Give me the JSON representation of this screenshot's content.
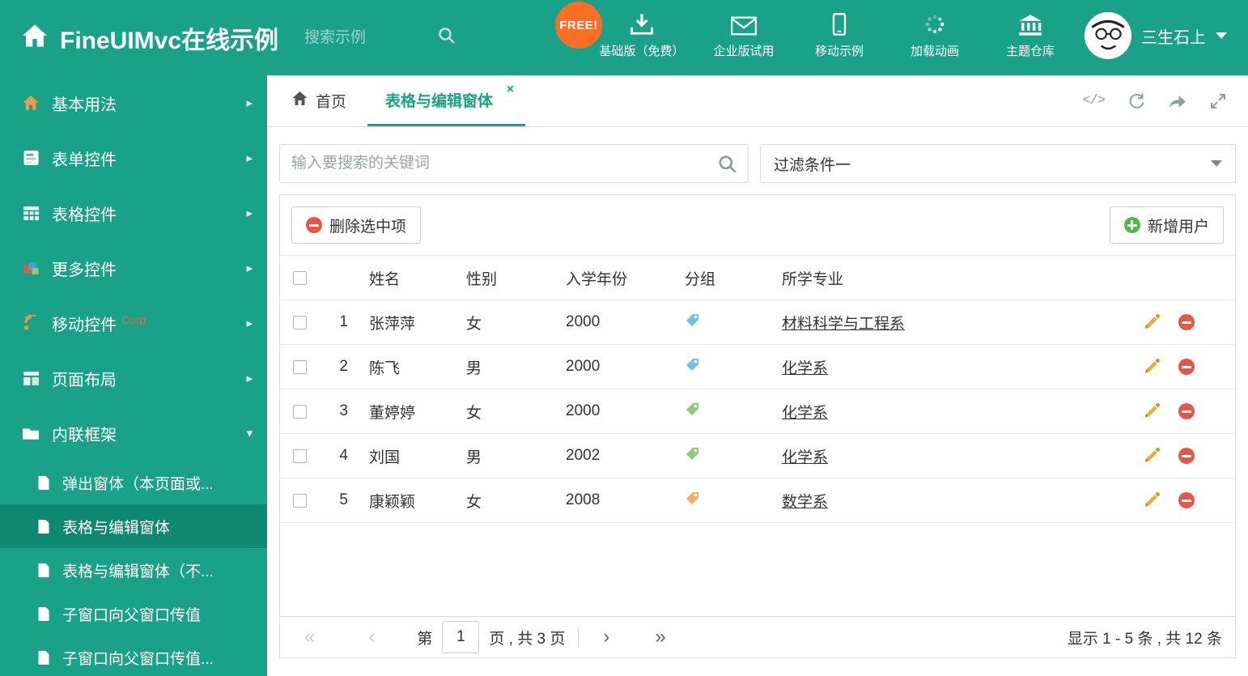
{
  "header": {
    "title": "FineUIMvc在线示例",
    "search_placeholder": "搜索示例",
    "free_badge": "FREE!",
    "nav": [
      {
        "label": "基础版（免费）",
        "icon": "download-icon"
      },
      {
        "label": "企业版试用",
        "icon": "envelope-icon"
      },
      {
        "label": "移动示例",
        "icon": "mobile-icon"
      },
      {
        "label": "加载动画",
        "icon": "spinner-icon"
      },
      {
        "label": "主题仓库",
        "icon": "bank-icon"
      }
    ],
    "username": "三生石上"
  },
  "sidebar": {
    "items": [
      {
        "label": "基本用法"
      },
      {
        "label": "表单控件"
      },
      {
        "label": "表格控件"
      },
      {
        "label": "更多控件"
      },
      {
        "label": "移动控件",
        "badge": "Corp"
      },
      {
        "label": "页面布局"
      },
      {
        "label": "内联框架"
      }
    ],
    "subitems": [
      {
        "label": "弹出窗体（本页面或..."
      },
      {
        "label": "表格与编辑窗体"
      },
      {
        "label": "表格与编辑窗体（不..."
      },
      {
        "label": "子窗口向父窗口传值"
      },
      {
        "label": "子窗口向父窗口传值..."
      }
    ]
  },
  "tabs": {
    "home": "首页",
    "active": "表格与编辑窗体",
    "close": "×"
  },
  "search": {
    "placeholder": "输入要搜索的关键词"
  },
  "filter": {
    "value": "过滤条件一"
  },
  "toolbar": {
    "delete_label": "删除选中项",
    "add_label": "新增用户"
  },
  "table": {
    "headers": {
      "name": "姓名",
      "gender": "性别",
      "year": "入学年份",
      "group": "分组",
      "major": "所学专业"
    },
    "rows": [
      {
        "num": "1",
        "name": "张萍萍",
        "gender": "女",
        "year": "2000",
        "tag_color": "#6FC3E8",
        "major": "材料科学与工程系"
      },
      {
        "num": "2",
        "name": "陈飞",
        "gender": "男",
        "year": "2000",
        "tag_color": "#6FC3E8",
        "major": "化学系"
      },
      {
        "num": "3",
        "name": "董婷婷",
        "gender": "女",
        "year": "2000",
        "tag_color": "#8FC975",
        "major": "化学系"
      },
      {
        "num": "4",
        "name": "刘国",
        "gender": "男",
        "year": "2002",
        "tag_color": "#8FC975",
        "major": "化学系"
      },
      {
        "num": "5",
        "name": "康颖颖",
        "gender": "女",
        "year": "2008",
        "tag_color": "#F3AE5B",
        "major": "数学系"
      }
    ]
  },
  "pagination": {
    "first": "«",
    "prev": "‹",
    "next": "›",
    "last": "»",
    "prefix": "第",
    "page": "1",
    "suffix": "页 , 共 3 页",
    "summary": "显示 1 - 5 条 , 共 12 条"
  },
  "colors": {
    "teal": "#1AA289",
    "teal_dark": "#0F8A70",
    "free_orange": "#FB6E26",
    "delete_red": "#E2574C",
    "add_green": "#53B556",
    "pencil_gold": "#E2B13C",
    "tag_blue": "#6FC3E8",
    "tag_green": "#8FC975",
    "tag_orange": "#F3AE5B",
    "corp_red": "#FF5A40"
  }
}
